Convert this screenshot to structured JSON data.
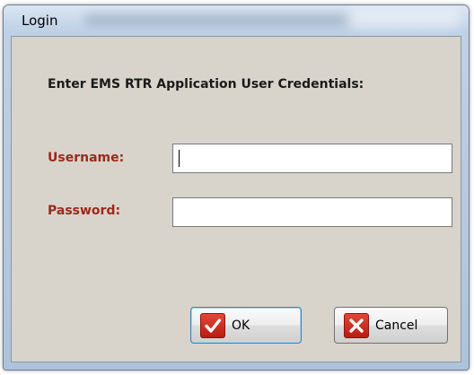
{
  "window": {
    "title": "Login"
  },
  "dialog": {
    "heading": "Enter EMS RTR Application User Credentials:",
    "username_label": "Username:",
    "username_value": "",
    "password_label": "Password:",
    "password_value": ""
  },
  "buttons": {
    "ok_label": "OK",
    "cancel_label": "Cancel"
  },
  "icons": {
    "ok": "checkmark-icon",
    "cancel": "x-cross-icon"
  },
  "colors": {
    "label_accent": "#9b2a1a",
    "dialog_background": "#d8d4cc",
    "icon_red": "#c8281b",
    "focus_border": "#3c7fb1"
  }
}
